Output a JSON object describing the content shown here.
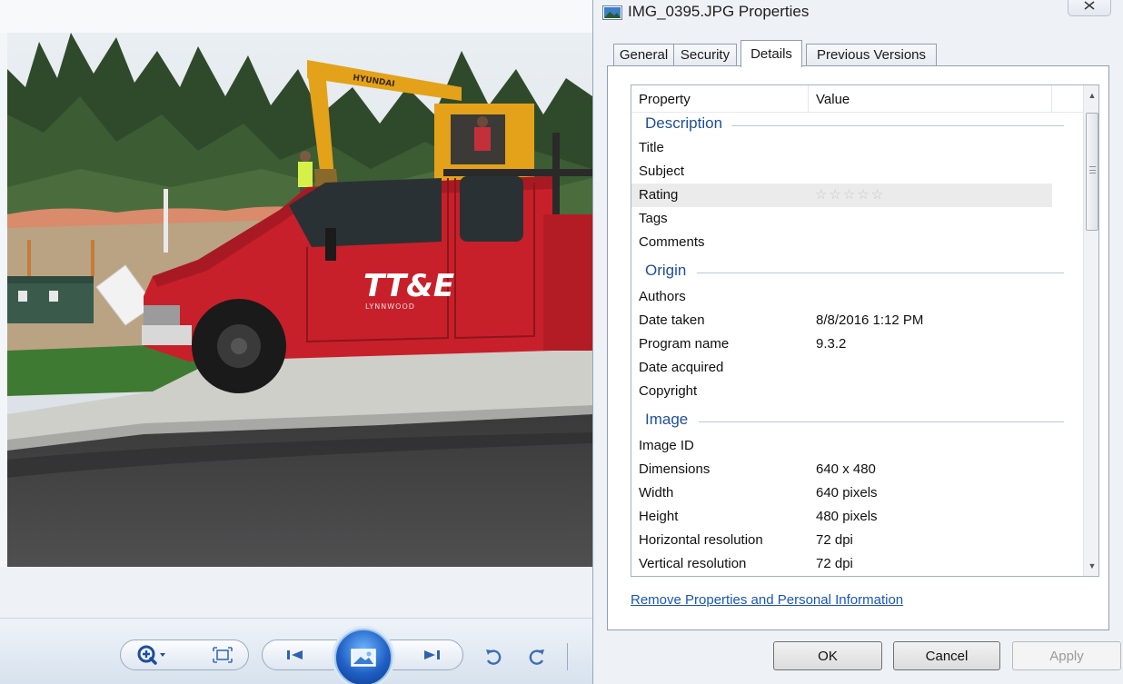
{
  "dialog": {
    "title": "IMG_0395.JPG Properties",
    "tabs": [
      {
        "label": "General",
        "active": false
      },
      {
        "label": "Security",
        "active": false
      },
      {
        "label": "Details",
        "active": true
      },
      {
        "label": "Previous Versions",
        "active": false
      }
    ],
    "list": {
      "columns": {
        "property": "Property",
        "value": "Value"
      },
      "groups": {
        "description": {
          "label": "Description",
          "rows": [
            {
              "name": "Title",
              "value": ""
            },
            {
              "name": "Subject",
              "value": ""
            },
            {
              "name": "Rating",
              "value": "",
              "stars_filled": 0,
              "stars_total": 5
            },
            {
              "name": "Tags",
              "value": ""
            },
            {
              "name": "Comments",
              "value": ""
            }
          ]
        },
        "origin": {
          "label": "Origin",
          "rows": [
            {
              "name": "Authors",
              "value": ""
            },
            {
              "name": "Date taken",
              "value": "8/8/2016 1:12 PM"
            },
            {
              "name": "Program name",
              "value": "9.3.2"
            },
            {
              "name": "Date acquired",
              "value": ""
            },
            {
              "name": "Copyright",
              "value": ""
            }
          ]
        },
        "image": {
          "label": "Image",
          "rows": [
            {
              "name": "Image ID",
              "value": ""
            },
            {
              "name": "Dimensions",
              "value": "640 x 480"
            },
            {
              "name": "Width",
              "value": "640 pixels"
            },
            {
              "name": "Height",
              "value": "480 pixels"
            },
            {
              "name": "Horizontal resolution",
              "value": "72 dpi"
            },
            {
              "name": "Vertical resolution",
              "value": "72 dpi"
            }
          ]
        }
      }
    },
    "remove_link": "Remove Properties and Personal Information",
    "buttons": {
      "ok": "OK",
      "cancel": "Cancel",
      "apply": "Apply"
    }
  },
  "photo": {
    "truck_logo": "TT&E",
    "truck_sub": "LYNNWOOD",
    "excavator_brand": "HYUNDAI"
  },
  "colors": {
    "group_header": "#1e4f99",
    "link": "#1a56b8",
    "truck_red": "#c8202a"
  },
  "icons": [
    "window-icon",
    "close-icon",
    "zoom-icon",
    "fit-icon",
    "previous-icon",
    "slideshow-icon",
    "next-icon",
    "rotate-left-icon",
    "rotate-right-icon",
    "star-icon",
    "scroll-up-icon",
    "scroll-down-icon"
  ]
}
